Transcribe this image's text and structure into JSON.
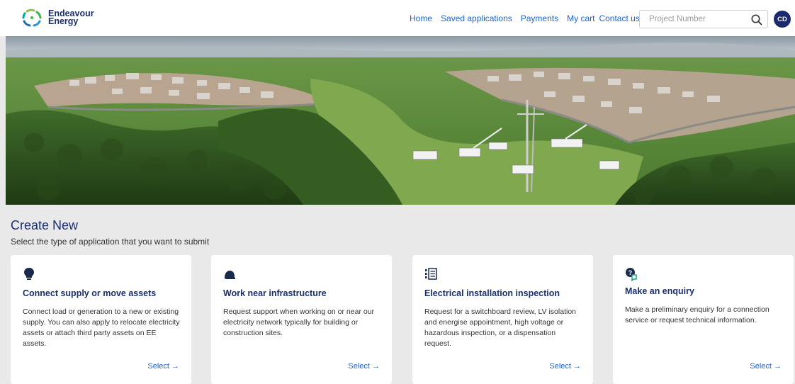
{
  "brand": {
    "line1": "Endeavour",
    "line2": "Energy"
  },
  "nav": [
    {
      "label": "Home"
    },
    {
      "label": "Saved applications"
    },
    {
      "label": "Payments"
    },
    {
      "label": "My cart"
    },
    {
      "label": "Contact us"
    }
  ],
  "search": {
    "placeholder": "Project Number",
    "value": ""
  },
  "user": {
    "initials": "CD"
  },
  "section": {
    "title": "Create New",
    "subtitle": "Select the type of application that you want to submit"
  },
  "cards": [
    {
      "icon": "lightbulb-icon",
      "title": "Connect supply or move assets",
      "description": "Connect load or generation to a new or existing supply. You can also apply to relocate electricity assets or attach third party assets on EE assets.",
      "action": "Select"
    },
    {
      "icon": "hard-hat-icon",
      "title": "Work near infrastructure",
      "description": "Request support when working on or near our electricity network typically for building or construction sites.",
      "action": "Select"
    },
    {
      "icon": "checklist-icon",
      "title": "Electrical installation inspection",
      "description": "Request for a switchboard review, LV isolation and energise appointment, high voltage or hazardous inspection, or a dispensation request.",
      "action": "Select"
    },
    {
      "icon": "question-chat-icon",
      "title": "Make an enquiry",
      "description": "Make a preliminary enquiry for a connection service or request technical information.",
      "action": "Select"
    }
  ],
  "colors": {
    "brand_navy": "#1a2f6d",
    "link_blue": "#1f63c9",
    "logo_green": "#3bb54a",
    "logo_blue": "#2a8fd6"
  }
}
